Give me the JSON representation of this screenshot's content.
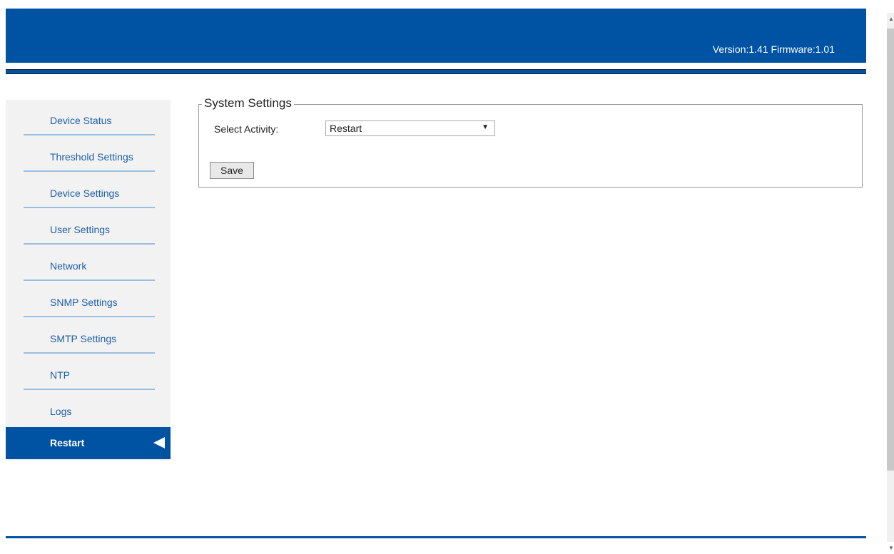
{
  "header": {
    "version_text": "Version:1.41 Firmware:1.01",
    "brand_color": "#0052a3"
  },
  "sidebar": {
    "items": [
      {
        "label": "Device Status",
        "active": false
      },
      {
        "label": "Threshold Settings",
        "active": false
      },
      {
        "label": "Device Settings",
        "active": false
      },
      {
        "label": "User Settings",
        "active": false
      },
      {
        "label": "Network",
        "active": false
      },
      {
        "label": "SNMP Settings",
        "active": false
      },
      {
        "label": "SMTP Settings",
        "active": false
      },
      {
        "label": "NTP",
        "active": false
      },
      {
        "label": "Logs",
        "active": false
      },
      {
        "label": "Restart",
        "active": true
      }
    ]
  },
  "panel": {
    "title": "System Settings",
    "select_label": "Select Activity:",
    "select_value": "Restart",
    "save_label": "Save"
  },
  "icons": {
    "active_arrow": "left-triangle",
    "select_arrow": "▼",
    "scroll_up": "▲",
    "scroll_down": "▼"
  }
}
